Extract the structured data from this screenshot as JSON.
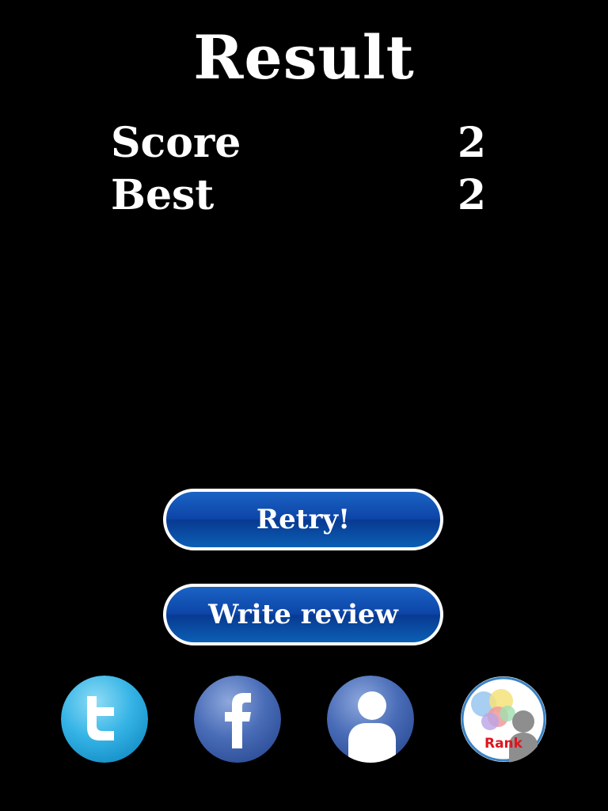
{
  "result": {
    "title": "Result"
  },
  "stats": {
    "score_label": "Score",
    "score_value": "2",
    "best_label": "Best",
    "best_value": "2"
  },
  "buttons": {
    "retry_label": "Retry!",
    "review_label": "Write review"
  },
  "social": {
    "twitter_icon": "twitter-icon",
    "facebook_icon": "facebook-icon",
    "profile_icon": "profile-icon",
    "rank_label": "Rank"
  },
  "colors": {
    "background": "#000000",
    "button_blue": "#0d45a8",
    "rank_red": "#e0141e"
  }
}
